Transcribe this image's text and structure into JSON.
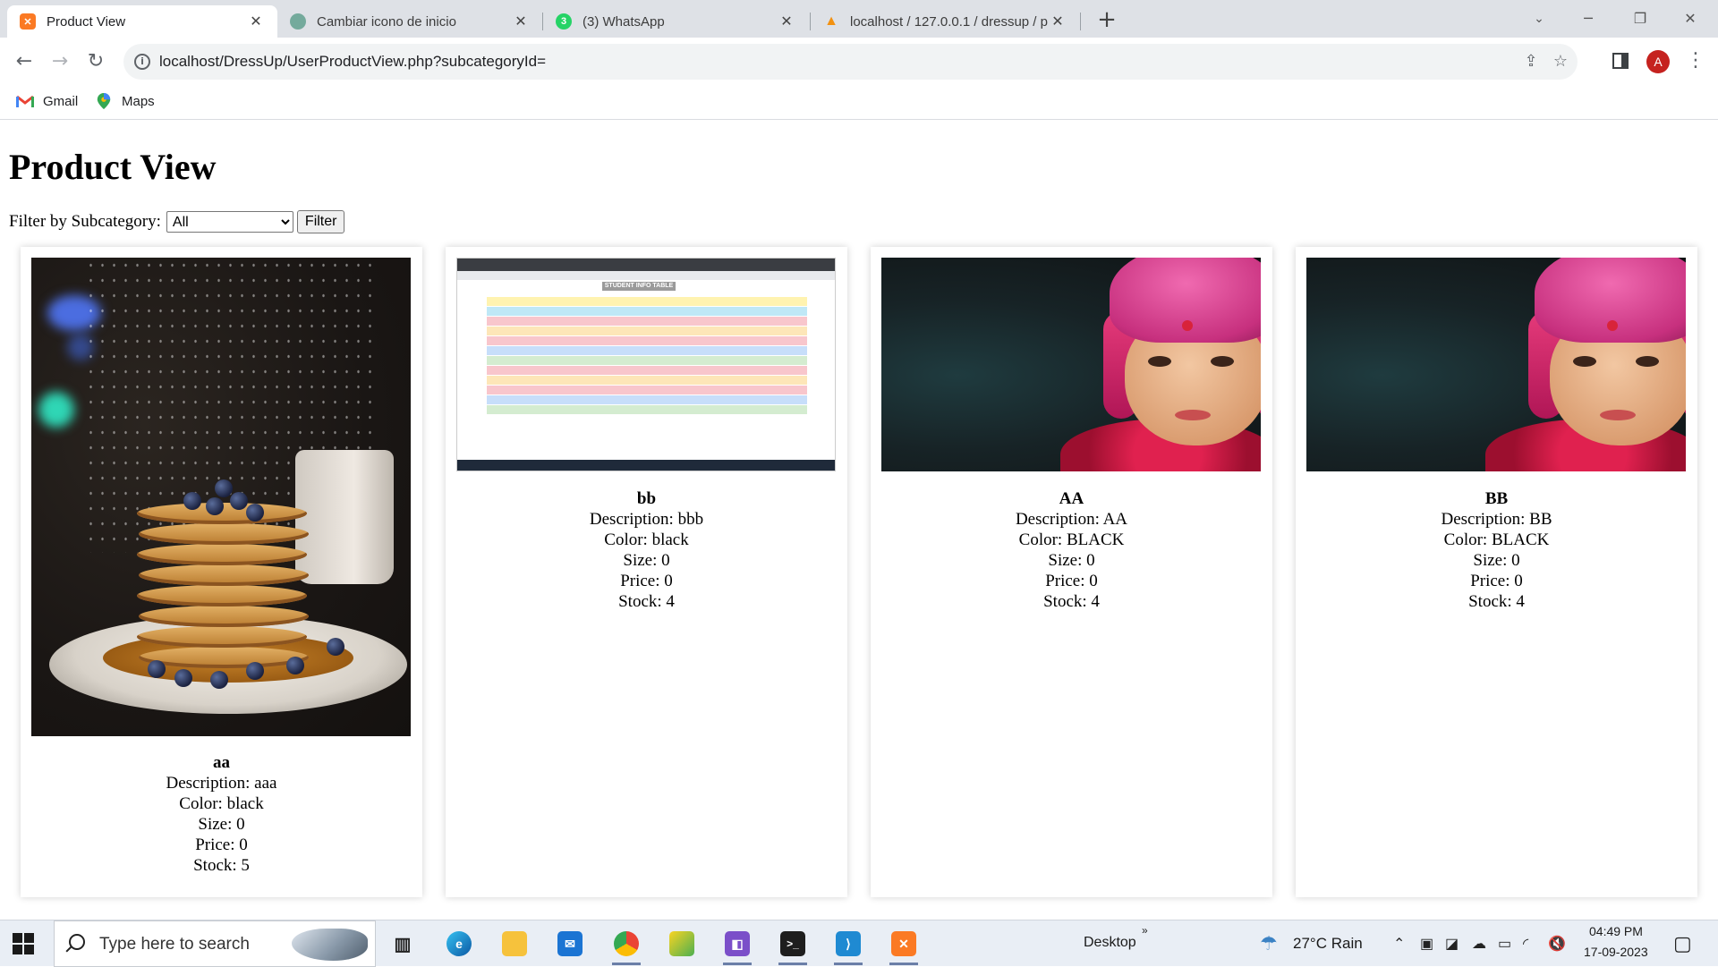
{
  "browser": {
    "tabs": [
      {
        "title": "Product View",
        "favicon": "xampp-icon",
        "color": "#fb7a24",
        "active": true
      },
      {
        "title": "Cambiar icono de inicio",
        "favicon": "openai-icon",
        "color": "#74aa9c",
        "active": false
      },
      {
        "title": "(3) WhatsApp",
        "favicon": "whatsapp-icon",
        "color": "#25d366",
        "badge": "3",
        "active": false
      },
      {
        "title": "localhost / 127.0.0.1 / dressup / p",
        "favicon": "phpmyadmin-icon",
        "color": "#f29111",
        "active": false
      }
    ],
    "url": "localhost/DressUp/UserProductView.php?subcategoryId=",
    "profile_initial": "A",
    "bookmarks": [
      {
        "label": "Gmail",
        "icon": "gmail-icon"
      },
      {
        "label": "Maps",
        "icon": "maps-icon"
      }
    ]
  },
  "page": {
    "title": "Product View",
    "filter": {
      "label": "Filter by Subcategory:",
      "selected": "All",
      "button": "Filter"
    },
    "products": [
      {
        "name": "aa",
        "description": "Description: aaa",
        "color": "Color: black",
        "size": "Size: 0",
        "price": "Price: 0",
        "stock": "Stock: 5",
        "image": "pancake-photo"
      },
      {
        "name": "bb",
        "description": "Description: bbb",
        "color": "Color: black",
        "size": "Size: 0",
        "price": "Price: 0",
        "stock": "Stock: 4",
        "image": "student-table-screenshot",
        "image_text": "STUDENT INFO TABLE"
      },
      {
        "name": "AA",
        "description": "Description: AA",
        "color": "Color: BLACK",
        "size": "Size: 0",
        "price": "Price: 0",
        "stock": "Stock: 4",
        "image": "portrait-painting"
      },
      {
        "name": "BB",
        "description": "Description: BB",
        "color": "Color: BLACK",
        "size": "Size: 0",
        "price": "Price: 0",
        "stock": "Stock: 4",
        "image": "portrait-painting"
      }
    ]
  },
  "taskbar": {
    "search_placeholder": "Type here to search",
    "apps": [
      "task-view-icon",
      "edge-icon",
      "file-explorer-icon",
      "mail-icon",
      "chrome-icon",
      "paint-icon",
      "visual-studio-icon",
      "terminal-icon",
      "vscode-icon",
      "xampp-icon"
    ],
    "desktop_label": "Desktop",
    "weather": "27°C  Rain",
    "time": "04:49 PM",
    "date": "17-09-2023"
  }
}
